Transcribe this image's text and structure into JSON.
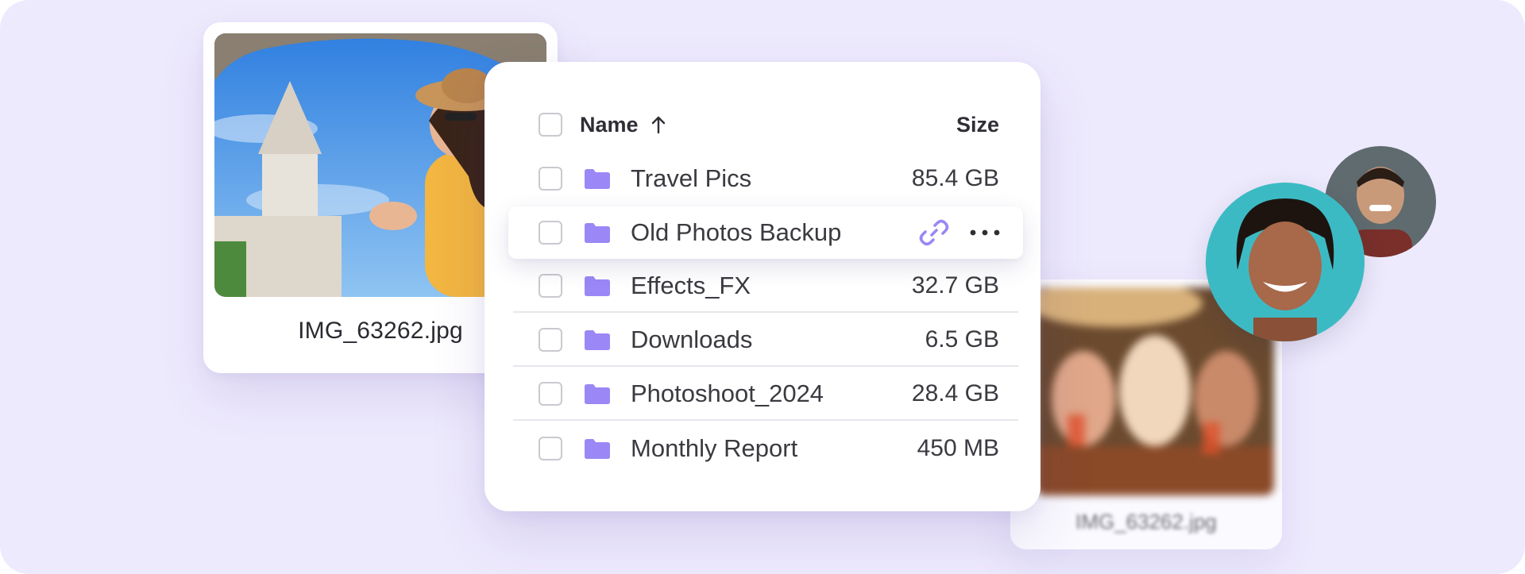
{
  "photo_card": {
    "caption": "IMG_63262.jpg"
  },
  "blurred_card": {
    "caption": "IMG_63262.jpg"
  },
  "file_list": {
    "header": {
      "name": "Name",
      "size": "Size",
      "sort_icon": "arrow-up-icon"
    },
    "rows": [
      {
        "name": "Travel Pics",
        "size": "85.4 GB"
      },
      {
        "name": "Old Photos Backup",
        "size": ""
      },
      {
        "name": "Effects_FX",
        "size": "32.7 GB"
      },
      {
        "name": "Downloads",
        "size": "6.5 GB"
      },
      {
        "name": "Photoshoot_2024",
        "size": "28.4 GB"
      },
      {
        "name": "Monthly Report",
        "size": "450 MB"
      }
    ],
    "row_icons": {
      "folder": "folder-icon",
      "link": "link-icon",
      "more": "more-horizontal-icon"
    }
  },
  "colors": {
    "background": "#eeeafd",
    "folder": "#9b87f5",
    "link": "#9b87f5",
    "divider": "#e7e7ec",
    "checkbox_border": "#c9c9cf"
  }
}
